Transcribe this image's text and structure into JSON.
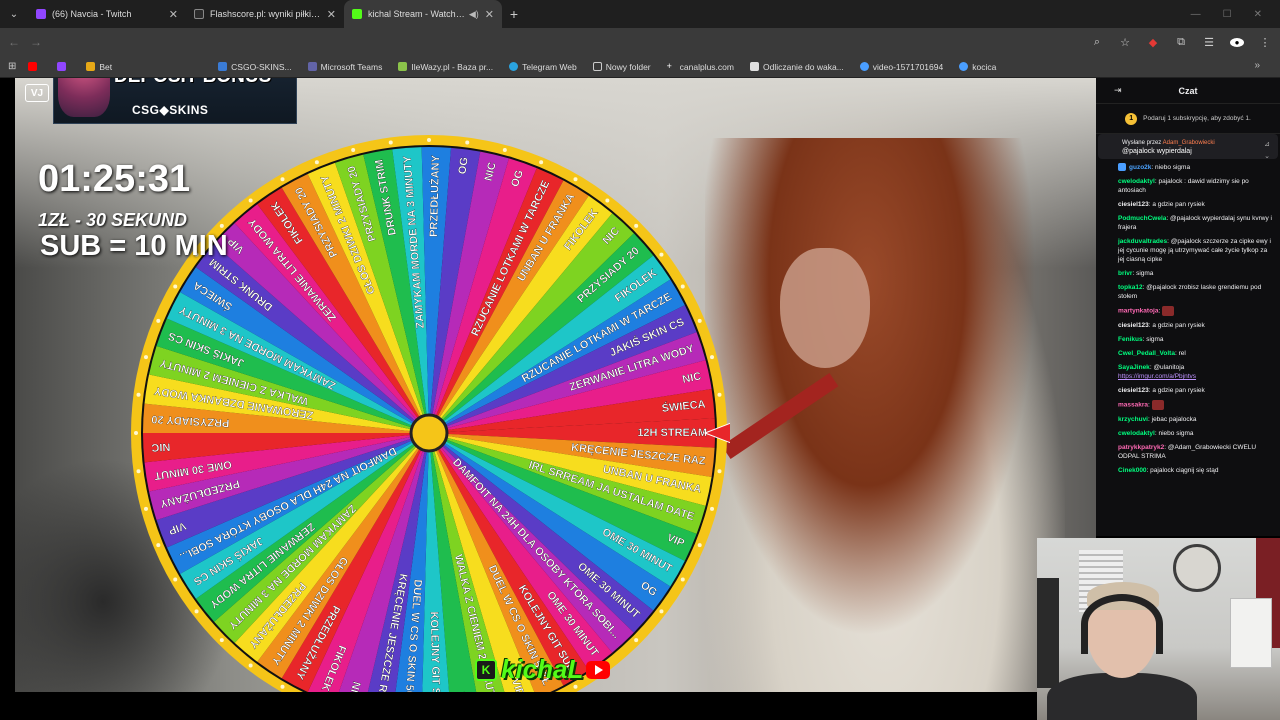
{
  "browser": {
    "tabs": [
      {
        "title": "(66) Navcia - Twitch",
        "icon": "twitch-icon",
        "color": "#9146ff",
        "active": false
      },
      {
        "title": "Flashscore.pl: wyniki piłki nożnej",
        "icon": "flashscore-icon",
        "color": "#2b2b2b",
        "active": false
      },
      {
        "title": "kichal Stream - Watch Live",
        "icon": "kick-icon",
        "color": "#53fc18",
        "active": true
      }
    ],
    "new_tab": "+",
    "bookmarks": [
      {
        "label": "",
        "icon": "youtube-icon",
        "color": "#ff0000"
      },
      {
        "label": "",
        "icon": "twitch-icon",
        "color": "#9146ff"
      },
      {
        "label": "Bet",
        "icon": "bookmark-icon",
        "color": "#e6a817"
      },
      {
        "label": "CSGO-SKINS...",
        "icon": "csgo-skins-icon",
        "color": "#3a7bd5"
      },
      {
        "label": "Microsoft Teams",
        "icon": "teams-icon",
        "color": "#6264a7"
      },
      {
        "label": "IleWazy.pl - Baza pr...",
        "icon": "bookmark-icon",
        "color": "#8bc34a"
      },
      {
        "label": "Telegram Web",
        "icon": "telegram-icon",
        "color": "#2aa3df"
      },
      {
        "label": "Nowy folder",
        "icon": "folder-icon",
        "color": "#cccccc"
      },
      {
        "label": "canalplus.com",
        "icon": "canalplus-icon",
        "color": "#ffffff"
      },
      {
        "label": "Odliczanie do waka...",
        "icon": "bookmark-icon",
        "color": "#e0e0e0"
      },
      {
        "label": "video-1571701694",
        "icon": "video-icon",
        "color": "#4a9eff"
      },
      {
        "label": "kocica",
        "icon": "globe-icon",
        "color": "#4a9eff"
      }
    ]
  },
  "stream": {
    "timer": "01:25:31",
    "rate_line1": "1ZŁ - 30 SEKUND",
    "rate_line2": "SUB = 10 MIN",
    "vj_badge": "VJ",
    "ad": {
      "promo": "GET $0.50 + 10% DEPOSIT BONUS",
      "brand": "CSG◆SKINS"
    },
    "brand_text": "kichaL",
    "wheel": {
      "colors": [
        "#e8262a",
        "#f08f1c",
        "#f7dd1e",
        "#7ed321",
        "#1fbd4e",
        "#1ec6c8",
        "#1e7fe0",
        "#5a3cc6",
        "#b62ab8",
        "#e81e8a"
      ],
      "rim": "#f5c518",
      "hub": "#f5c518",
      "pointer": "#e8262a",
      "segments": [
        "12H STREAM",
        "KRĘCENIE JESZCZE RAZ",
        "UNBAN U FRANKA",
        "IRL SRREAM JA USTALAM DATE",
        "VIP",
        "OME 30 MINUT",
        "OG",
        "OME 30 MINUT",
        "DAMFOIT NA 24H DLA OSOBY KTÓRA SOBI...",
        "OME 30 MINUT",
        "KOLEJNY GIT SUB",
        "DUEL W CS O SKIN 50ZŁ",
        "VIP",
        "WALKA Z CIENIEM 2 MINUTY",
        "OG",
        "KOLEJNY GIT SUB",
        "DUEL W CS O SKIN 50ZŁ",
        "KRĘCENIE JESZCZE RAZ",
        "NIC",
        "FIKOLEK",
        "PRZEDŁUŻANY",
        "GŁOS DZIWKI 2 MINUTY",
        "PRZEDŁUŻANY",
        "ZAMYKAM MORDE NA 3 MINUTY",
        "ZERWANIE LITRA WODY",
        "JAKIŚ SKIN CS",
        "DAMFOIT NA 24H DLA OSOBY KTÓRA SOBI...",
        "VIP",
        "PRZEDŁUŻANY",
        "OME 30 MINUT",
        "NIC",
        "PRZYSIADY 20",
        "ZEROWANIE DZBANKA WODY",
        "WALKA Z CIENIEM 2 MINUTY",
        "JAKIŚ SKIN CS",
        "ZAMYKAM MORDE NA 3 MINUTY",
        "ŚWIECA",
        "DRUNK STRIM",
        "VIP",
        "ZERWANIE LITRA WODY",
        "FIKOLEK",
        "PRZYSIADY 20",
        "GŁOS DZIWKI 2 MINUTY",
        "PRZYSIADY 20",
        "DRUNK STRIM",
        "ZAMYKAM MORDE NA 3 MINUTY",
        "PRZEDŁUŻANY",
        "OG",
        "NIC",
        "OG",
        "RZUCANIE LOTKAMI W TARCZE",
        "UNBAN U FRANKA",
        "FIKOLEK",
        "NIC",
        "PRZYSIADY 20",
        "FIKOLEK",
        "RZUCANIE LOTKAMI W TARCZE",
        "JAKIŚ SKIN CS",
        "ZERWANIE LITRA WODY",
        "NIC",
        "ŚWIECA"
      ]
    }
  },
  "chat": {
    "title": "Czat",
    "sub_goal": "Podaruj 1 subskrypcję, aby zdobyć 1.",
    "pinned_label": "Wysłane przez",
    "pinned_by": "Adam_Grabowiecki",
    "pinned_msg": "@pajalock wypierdalaj",
    "messages": [
      {
        "user": "guzo2k",
        "color": "#4ba3ff",
        "text": "niebo sigma",
        "badge": true
      },
      {
        "user": "cweloda​ktyl",
        "color": "#00ff7f",
        "text": "pajalock : dawid widzimy sie po antosiach"
      },
      {
        "user": "ciesiel123",
        "color": "#efeff1",
        "text": "a gdzie pan rysiek"
      },
      {
        "user": "PodmuchCwela",
        "color": "#00ff7f",
        "text": "@pajalock wypierdalaj synu kvrwy i frajera"
      },
      {
        "user": "jackduvaltrades",
        "color": "#00ff7f",
        "text": "@pajalock szczerze za cipke ewy i jej cycunie mogę ją utrzymywać całe życie tylkop za jej ciasną cipke"
      },
      {
        "user": "brivr",
        "color": "#00ff7f",
        "text": "sigma"
      },
      {
        "user": "topka12",
        "color": "#00ff7f",
        "text": "@pajalock zrobisz laske grendiemu pod stołem"
      },
      {
        "user": "martynkatoja",
        "color": "#ff69b4",
        "text": "",
        "emote": true
      },
      {
        "user": "ciesiel123",
        "color": "#efeff1",
        "text": "a gdzie pan rysiek"
      },
      {
        "user": "Fenikus",
        "color": "#00ff7f",
        "text": "sigma"
      },
      {
        "user": "Cwel_Pedall_Volta",
        "color": "#00ff7f",
        "text": "rel"
      },
      {
        "user": "SayaJinek",
        "color": "#00ff7f",
        "text": "@ulanitoja",
        "link": "https://imgur.com/a/Pbjntvs"
      },
      {
        "user": "ciesiel123",
        "color": "#efeff1",
        "text": "a gdzie pan rysiek"
      },
      {
        "user": "massakra",
        "color": "#ff69b4",
        "text": "",
        "emote": true
      },
      {
        "user": "krzychuvi",
        "color": "#00ff7f",
        "text": "jebac pajalocka"
      },
      {
        "user": "cweloda​ktyl",
        "color": "#00ff7f",
        "text": "niebo sigma"
      },
      {
        "user": "patrykkpatryk2",
        "color": "#ff69b4",
        "text": "@Adam_Grabowiecki CWELU ODPAL STRIMA"
      },
      {
        "user": "Cinek000",
        "color": "#00ff7f",
        "text": "pajalock ciągnij się stąd"
      }
    ]
  }
}
